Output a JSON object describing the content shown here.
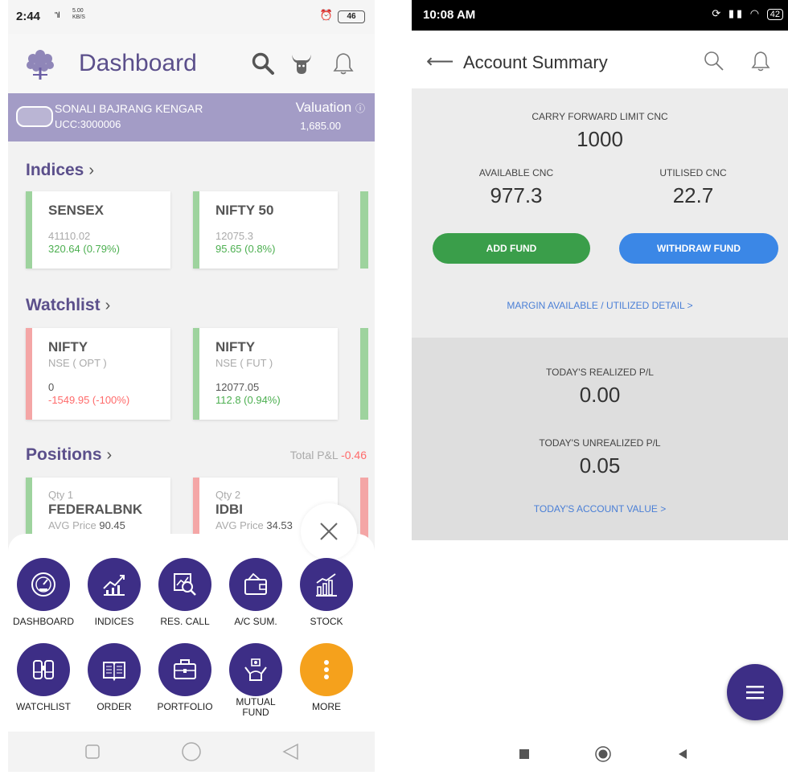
{
  "left": {
    "status_bar": {
      "time": "2:44",
      "signal": "\"ıl",
      "net_rate": "5.00",
      "net_unit": "KB/S",
      "battery": "46"
    },
    "app_bar": {
      "title": "Dashboard"
    },
    "user": {
      "name": "SONALI BAJRANG KENGAR",
      "ucc": "UCC:3000006",
      "valuation_label": "Valuation",
      "valuation_value": "1,685.00"
    },
    "indices": {
      "heading": "Indices",
      "items": [
        {
          "name": "SENSEX",
          "value": "41110.02",
          "change": "320.64 (0.79%)"
        },
        {
          "name": "NIFTY 50",
          "value": "12075.3",
          "change": "95.65 (0.8%)"
        }
      ]
    },
    "watchlist": {
      "heading": "Watchlist",
      "items": [
        {
          "name": "NIFTY",
          "segment": "NSE ( OPT )",
          "value": "0",
          "change": "-1549.95 (-100%)"
        },
        {
          "name": "NIFTY",
          "segment": "NSE ( FUT )",
          "value": "12077.05",
          "change": "112.8 (0.94%)"
        }
      ]
    },
    "positions": {
      "heading": "Positions",
      "total_label": "Total P&L",
      "total_value": "-0.46",
      "items": [
        {
          "qty": "Qty 1",
          "symbol": "FEDERALBNK",
          "avg_label": "AVG Price",
          "avg_value": "90.45"
        },
        {
          "qty": "Qty 2",
          "symbol": "IDBI",
          "avg_label": "AVG Price",
          "avg_value": "34.53"
        }
      ]
    },
    "menu": {
      "row1": [
        "DASHBOARD",
        "INDICES",
        "RES. CALL",
        "A/C SUM.",
        "STOCK"
      ],
      "row2": [
        "WATCHLIST",
        "ORDER",
        "PORTFOLIO",
        "MUTUAL FUND",
        "MORE"
      ]
    },
    "colors": {
      "brand": "#3d2e86",
      "accent": "#5b4f8b",
      "more": "#f5a11c",
      "gain": "#4caf50",
      "loss": "#ff6b6b"
    }
  },
  "right": {
    "status_bar": {
      "time": "10:08 AM",
      "battery": "42"
    },
    "app_bar": {
      "title": "Account Summary"
    },
    "carry_forward": {
      "label": "CARRY FORWARD LIMIT CNC",
      "value": "1000"
    },
    "available": {
      "label": "AVAILABLE CNC",
      "value": "977.3"
    },
    "utilised": {
      "label": "UTILISED CNC",
      "value": "22.7"
    },
    "buttons": {
      "add": "ADD FUND",
      "withdraw": "WITHDRAW FUND"
    },
    "margin_link": "MARGIN AVAILABLE / UTILIZED DETAIL >",
    "realized": {
      "label": "TODAY'S REALIZED P/L",
      "value": "0.00"
    },
    "unrealized": {
      "label": "TODAY'S UNREALIZED P/L",
      "value": "0.05"
    },
    "account_value_link": "TODAY'S ACCOUNT VALUE >",
    "colors": {
      "add": "#3a9e4a",
      "withdraw": "#3b87e6",
      "link": "#4a7fd6"
    }
  }
}
